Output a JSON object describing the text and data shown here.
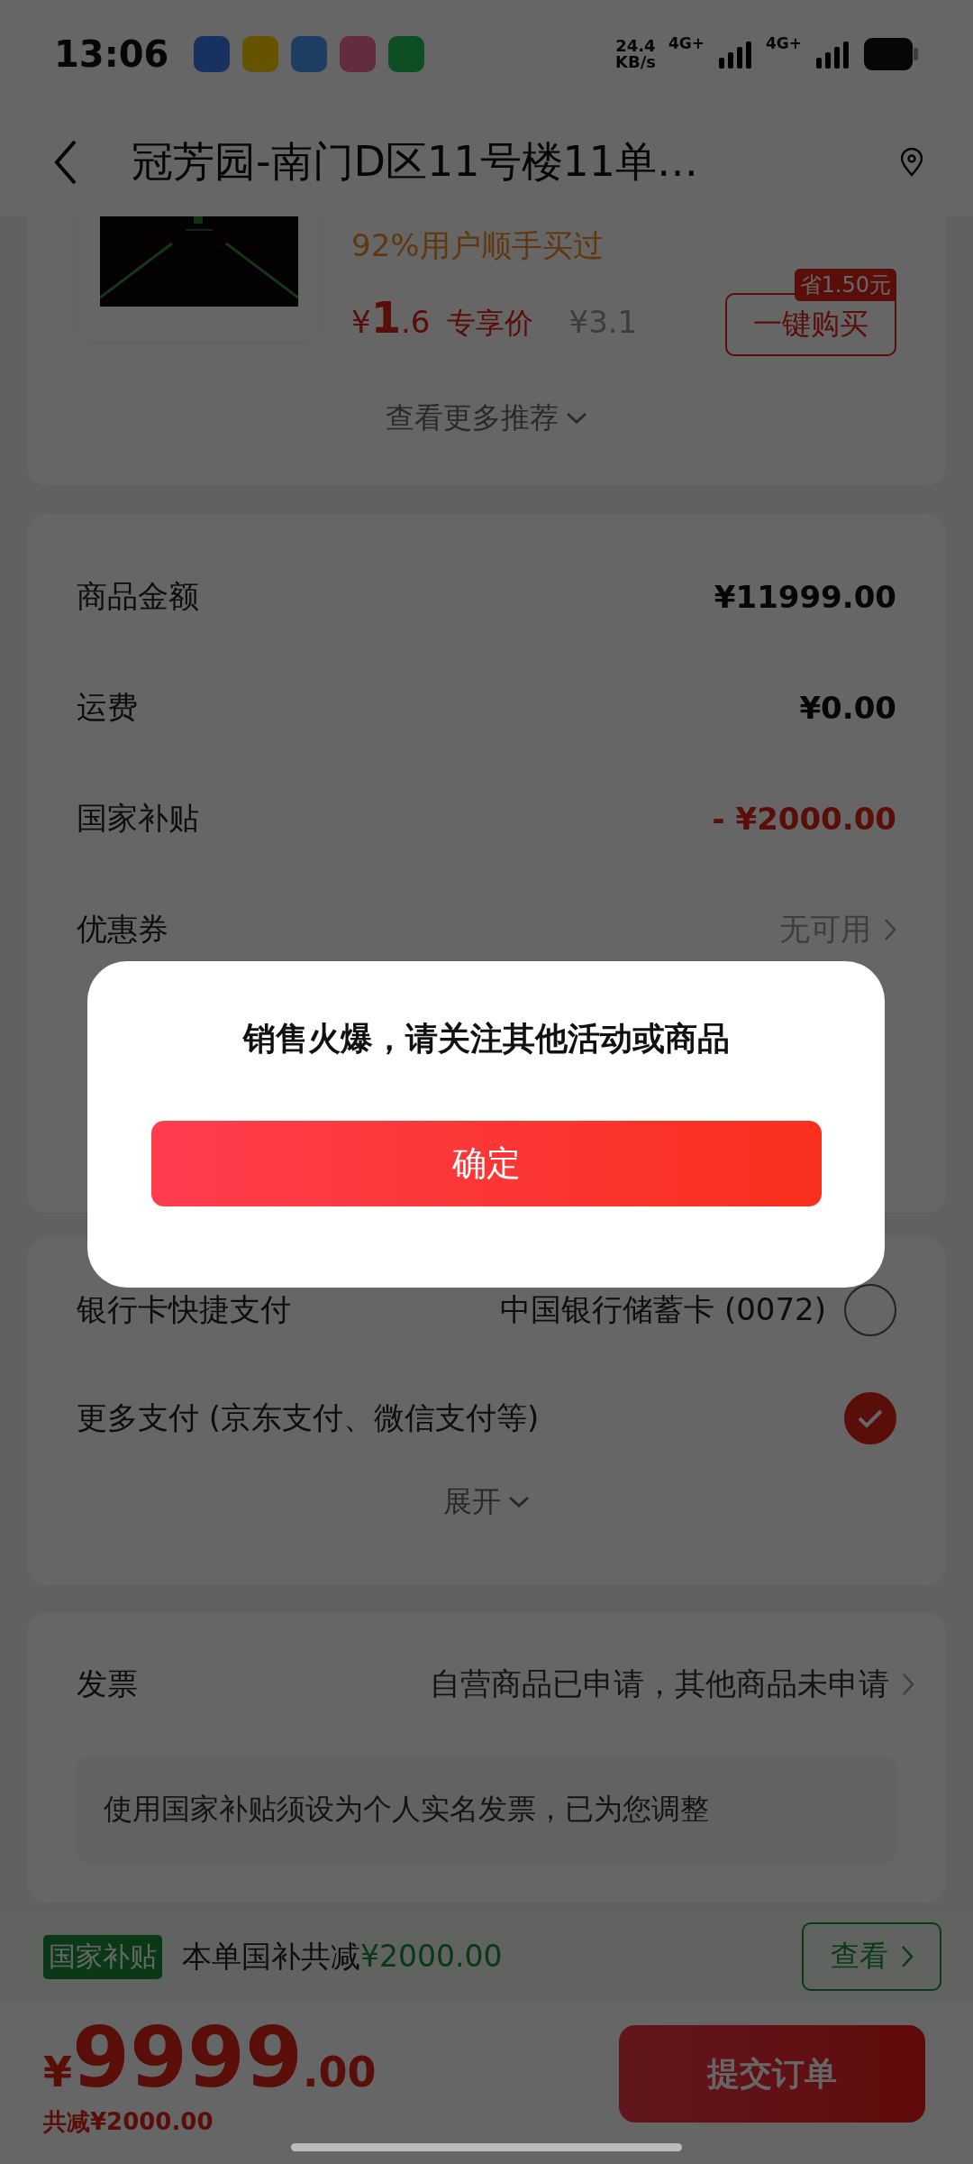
{
  "status_bar": {
    "time": "13:06",
    "speed": "24.4",
    "speed_unit": "KB/s",
    "networks": [
      "4G+",
      "4G+"
    ]
  },
  "header": {
    "title": "冠芳园-南门D区11号楼11单…"
  },
  "recommendation": {
    "note": "92%用户顺手买过",
    "currency": "¥",
    "price_int": "1",
    "price_dec": ".6",
    "price_label": "专享价",
    "original_price": "¥3.1",
    "save_badge": "省1.50元",
    "buy_button": "一键购买",
    "more": "查看更多推荐"
  },
  "summary": [
    {
      "kind": "value",
      "label": "商品金额",
      "value": "¥11999.00"
    },
    {
      "kind": "value",
      "label": "运费",
      "value": "¥0.00"
    },
    {
      "kind": "discount",
      "label": "国家补贴",
      "value": "- ¥2000.00"
    },
    {
      "kind": "link",
      "label": "优惠券",
      "value": "无可用"
    }
  ],
  "payment": {
    "options": [
      {
        "label": "银行卡快捷支付",
        "detail": "中国银行储蓄卡 (0072)",
        "selected": false
      },
      {
        "label": "更多支付 (京东支付、微信支付等)",
        "selected": true
      }
    ],
    "expand": "展开"
  },
  "invoice": {
    "label": "发票",
    "value": "自营商品已申请，其他商品未申请",
    "note": "使用国家补贴须设为个人实名发票，已为您调整"
  },
  "subsidy_bar": {
    "tag": "国家补贴",
    "text": "本单国补共减",
    "amount": "¥2000.00",
    "button": "查看"
  },
  "checkout": {
    "currency": "¥",
    "total_int": "9999",
    "total_dec": ".00",
    "saved": "共减¥2000.00",
    "submit": "提交订单"
  },
  "dialog": {
    "message": "销售火爆，请关注其他活动或商品",
    "confirm": "确定"
  }
}
